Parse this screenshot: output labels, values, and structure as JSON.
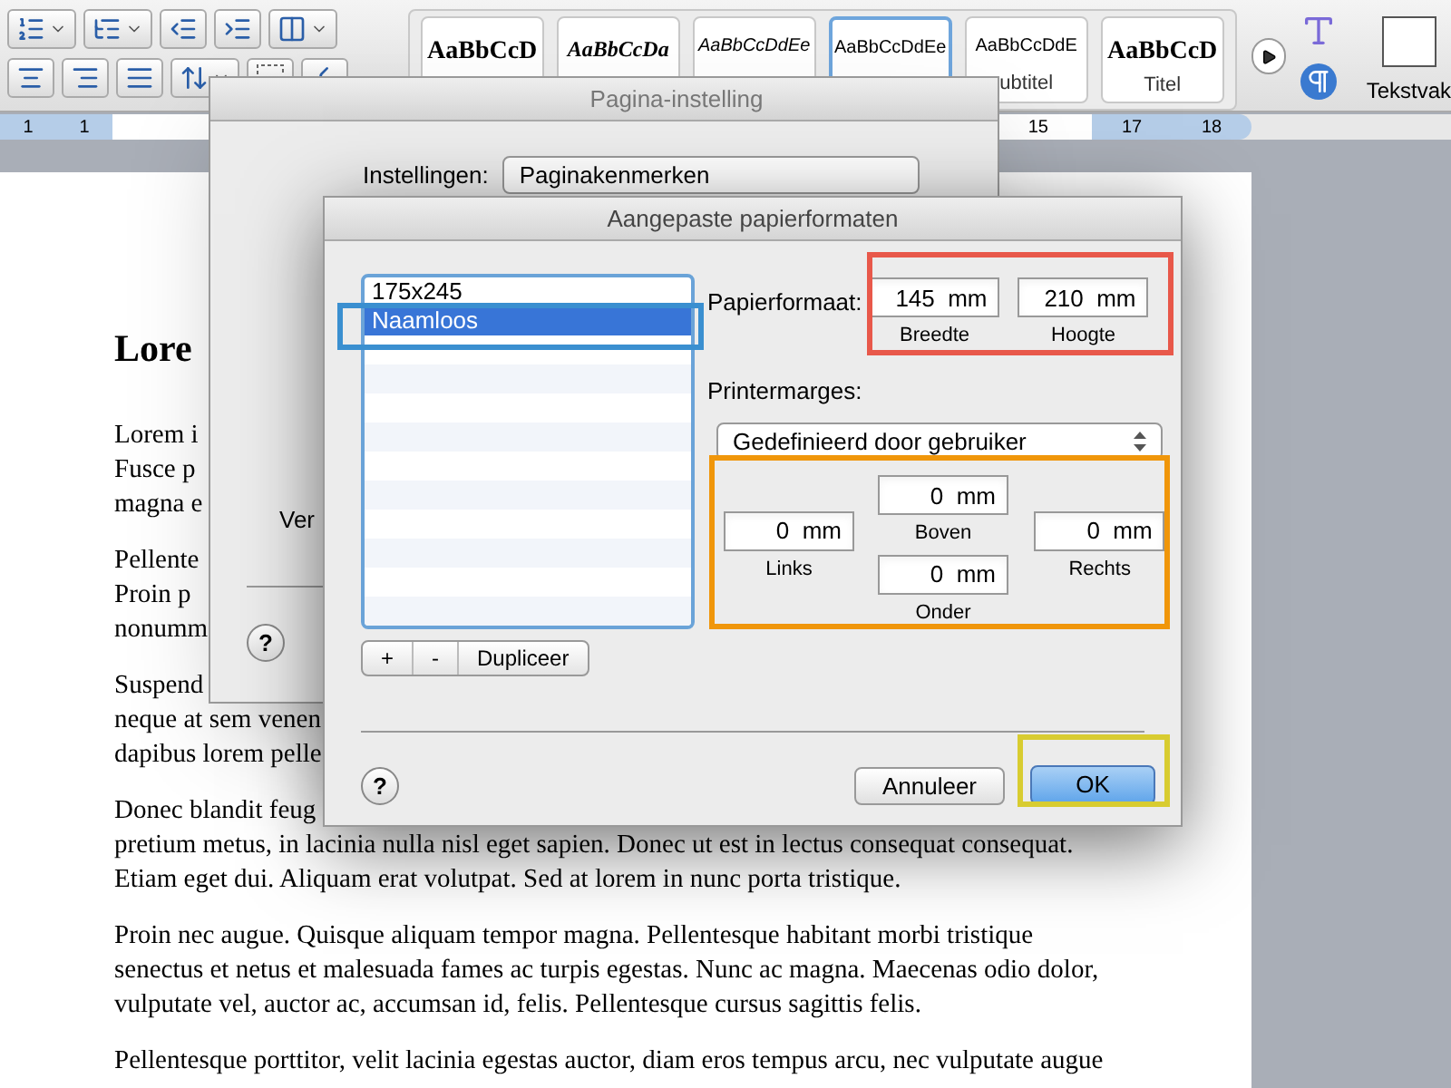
{
  "toolbar": {
    "style_gallery": [
      {
        "sample": "AaBbCcD",
        "kind": "bold",
        "selected": false
      },
      {
        "sample": "AaBbCcDa",
        "kind": "bolditalic",
        "selected": false
      },
      {
        "sample": "AaBbCcDdEe",
        "kind": "smallitalic",
        "selected": false
      },
      {
        "sample": "AaBbCcDdEe",
        "kind": "plain",
        "selected": true
      },
      {
        "sample": "AaBbCcDdE",
        "kind": "plain",
        "selected": false,
        "label": "ubtitel"
      },
      {
        "sample": "AaBbCcD",
        "kind": "title",
        "selected": false,
        "label": "Titel"
      }
    ],
    "text_box_label": "Tekstvak"
  },
  "ruler": {
    "left_numbers": [
      "1",
      "1"
    ],
    "right_numbers": [
      "15",
      "17",
      "18"
    ]
  },
  "document": {
    "heading": "Lore",
    "paragraphs": [
      {
        "lines": [
          "Lorem i",
          "Fusce p",
          "magna e"
        ]
      },
      {
        "lines": [
          "Pellente",
          "Proin p",
          "nonumm"
        ]
      },
      {
        "lines": [
          "Suspend",
          "neque at sem venen",
          "dapibus lorem pelle"
        ]
      },
      {
        "lines": [
          "Donec blandit feug",
          "pretium metus, in lacinia nulla nisl eget sapien. Donec ut est in lectus consequat consequat.",
          "Etiam eget dui. Aliquam erat volutpat. Sed at lorem in nunc porta tristique."
        ]
      },
      {
        "lines": [
          "Proin nec augue. Quisque aliquam tempor magna. Pellentesque habitant morbi tristique",
          "senectus et netus et malesuada fames ac turpis egestas. Nunc ac magna. Maecenas odio dolor,",
          "vulputate vel, auctor ac, accumsan id, felis. Pellentesque cursus sagittis felis."
        ]
      },
      {
        "lines": [
          "Pellentesque porttitor, velit lacinia egestas auctor, diam eros tempus arcu, nec vulputate augue"
        ]
      }
    ]
  },
  "page_setup_dialog": {
    "title": "Pagina-instelling",
    "settings_label": "Instellingen:",
    "settings_value": "Paginakenmerken",
    "partial_label": "Ver",
    "help": "?"
  },
  "custom_sizes_dialog": {
    "title": "Aangepaste papierformaten",
    "sizes": [
      {
        "label": "175x245",
        "selected": false
      },
      {
        "label": "Naamloos",
        "selected": true
      }
    ],
    "add": "+",
    "remove": "-",
    "duplicate": "Dupliceer",
    "paper_size_label": "Papierformaat:",
    "width": {
      "value": "145  mm",
      "caption": "Breedte"
    },
    "height": {
      "value": "210  mm",
      "caption": "Hoogte"
    },
    "margins_label": "Printermarges:",
    "margins_preset": "Gedefinieerd door gebruiker",
    "margins": {
      "top": {
        "value": "0  mm",
        "caption": "Boven"
      },
      "left": {
        "value": "0  mm",
        "caption": "Links"
      },
      "right": {
        "value": "0  mm",
        "caption": "Rechts"
      },
      "bottom": {
        "value": "0  mm",
        "caption": "Onder"
      }
    },
    "help": "?",
    "cancel": "Annuleer",
    "ok": "OK"
  },
  "highlights": [
    {
      "kind": "size-list",
      "color": "#3a8fd0"
    },
    {
      "kind": "paper-size",
      "color": "#e8584a"
    },
    {
      "kind": "margins",
      "color": "#f0960a"
    },
    {
      "kind": "ok",
      "color": "#d8cc30"
    }
  ]
}
